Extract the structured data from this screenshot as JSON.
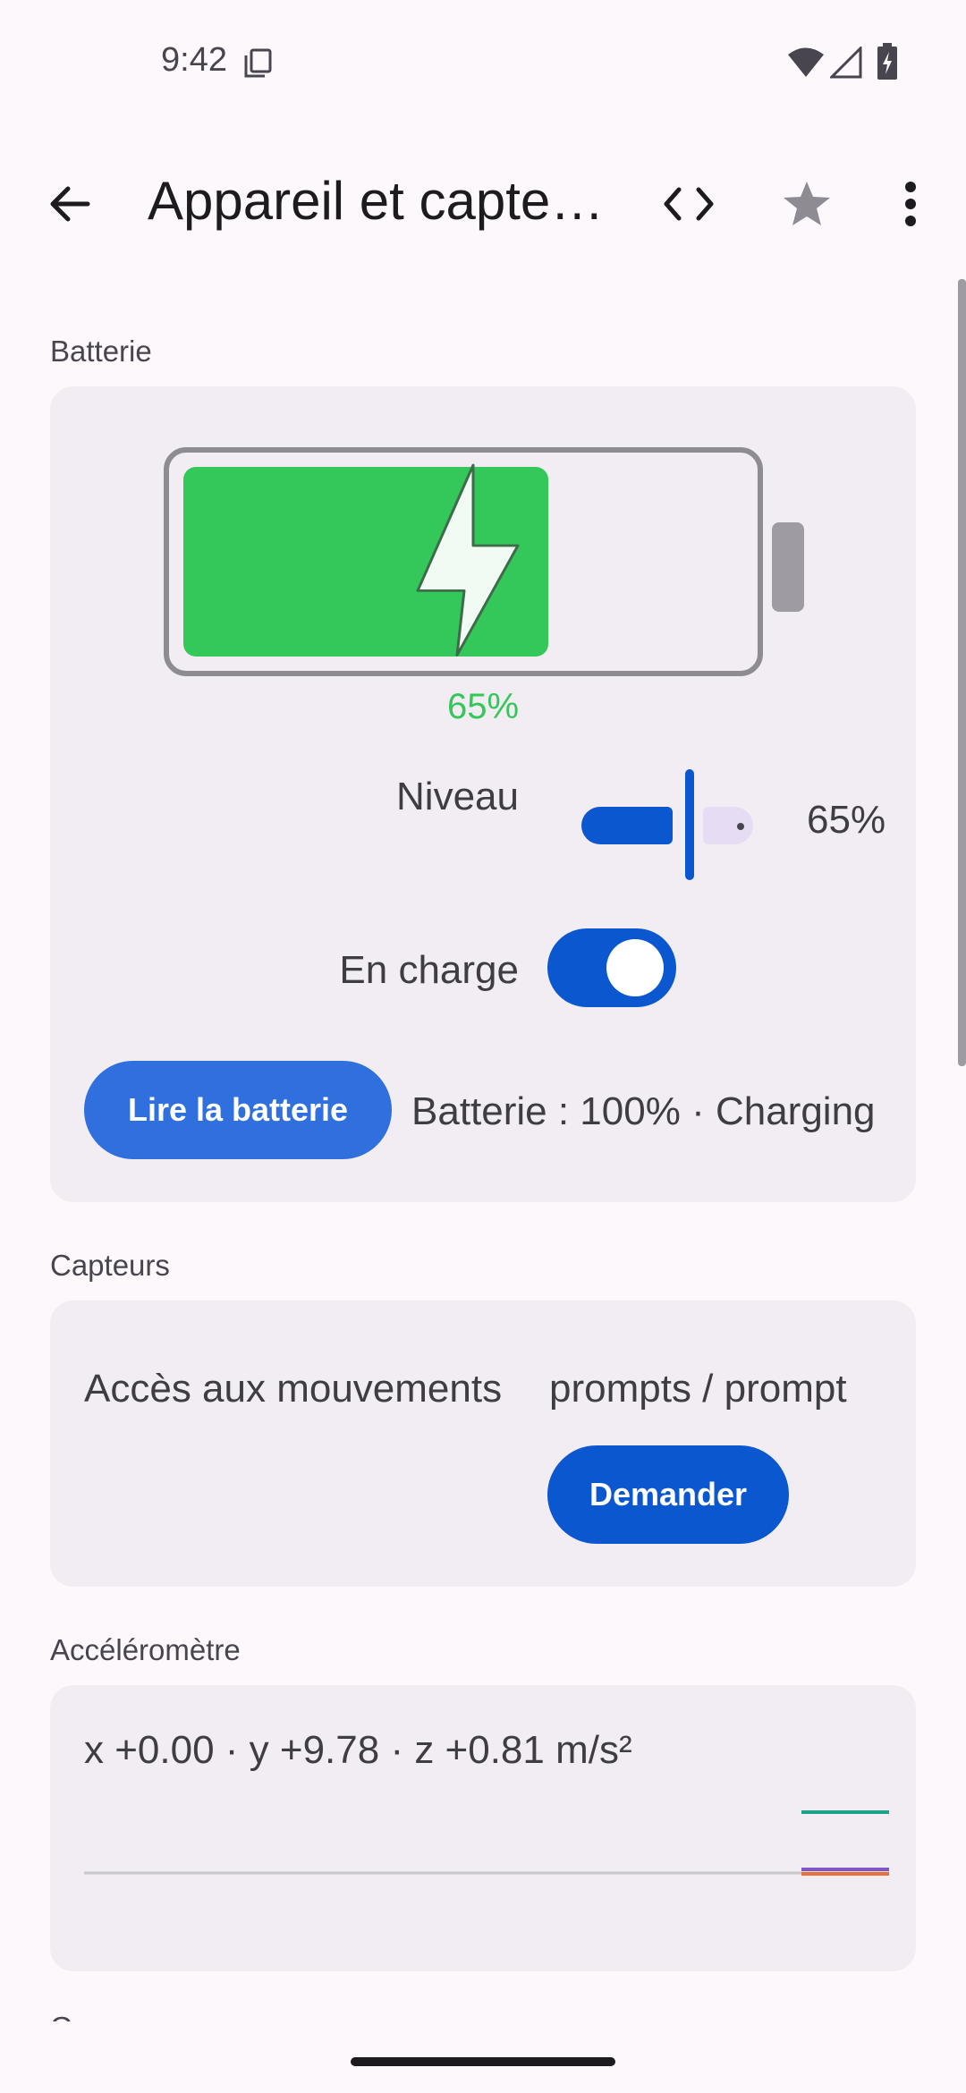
{
  "status_bar": {
    "time": "9:42",
    "icons": [
      "copy-icon",
      "wifi-icon",
      "signal-icon",
      "battery-charging-icon"
    ]
  },
  "app_bar": {
    "title": "Appareil et capteurs",
    "back_icon": "arrow-left-icon",
    "code_icon": "code-icon",
    "star_icon": "star-icon",
    "more_icon": "more-vertical-icon"
  },
  "battery_section": {
    "label": "Batterie",
    "graphic_level": 0.65,
    "graphic_percent": "65%",
    "level_label": "Niveau",
    "level_value": "65%",
    "level_fraction": 0.65,
    "charging_label": "En charge",
    "charging_on": true,
    "read_button": "Lire la batterie",
    "status_text": "Batterie : 100% · Charging"
  },
  "sensors_section": {
    "label": "Capteurs",
    "motion_label": "Accès aux mouvements",
    "motion_value": "prompts / prompt",
    "ask_button": "Demander"
  },
  "accelerometer_section": {
    "label": "Accéléromètre",
    "readout": "x +0.00 · y +9.78 · z +0.81 m/s²",
    "legend_colors": [
      "#1ea18a",
      "#7e57c2",
      "#e8703a"
    ]
  },
  "gyroscope_section": {
    "label": "Gyroscope"
  },
  "colors": {
    "primary": "#0b57d0",
    "battery_green": "#34c759",
    "card_bg": "#f1edf3"
  }
}
